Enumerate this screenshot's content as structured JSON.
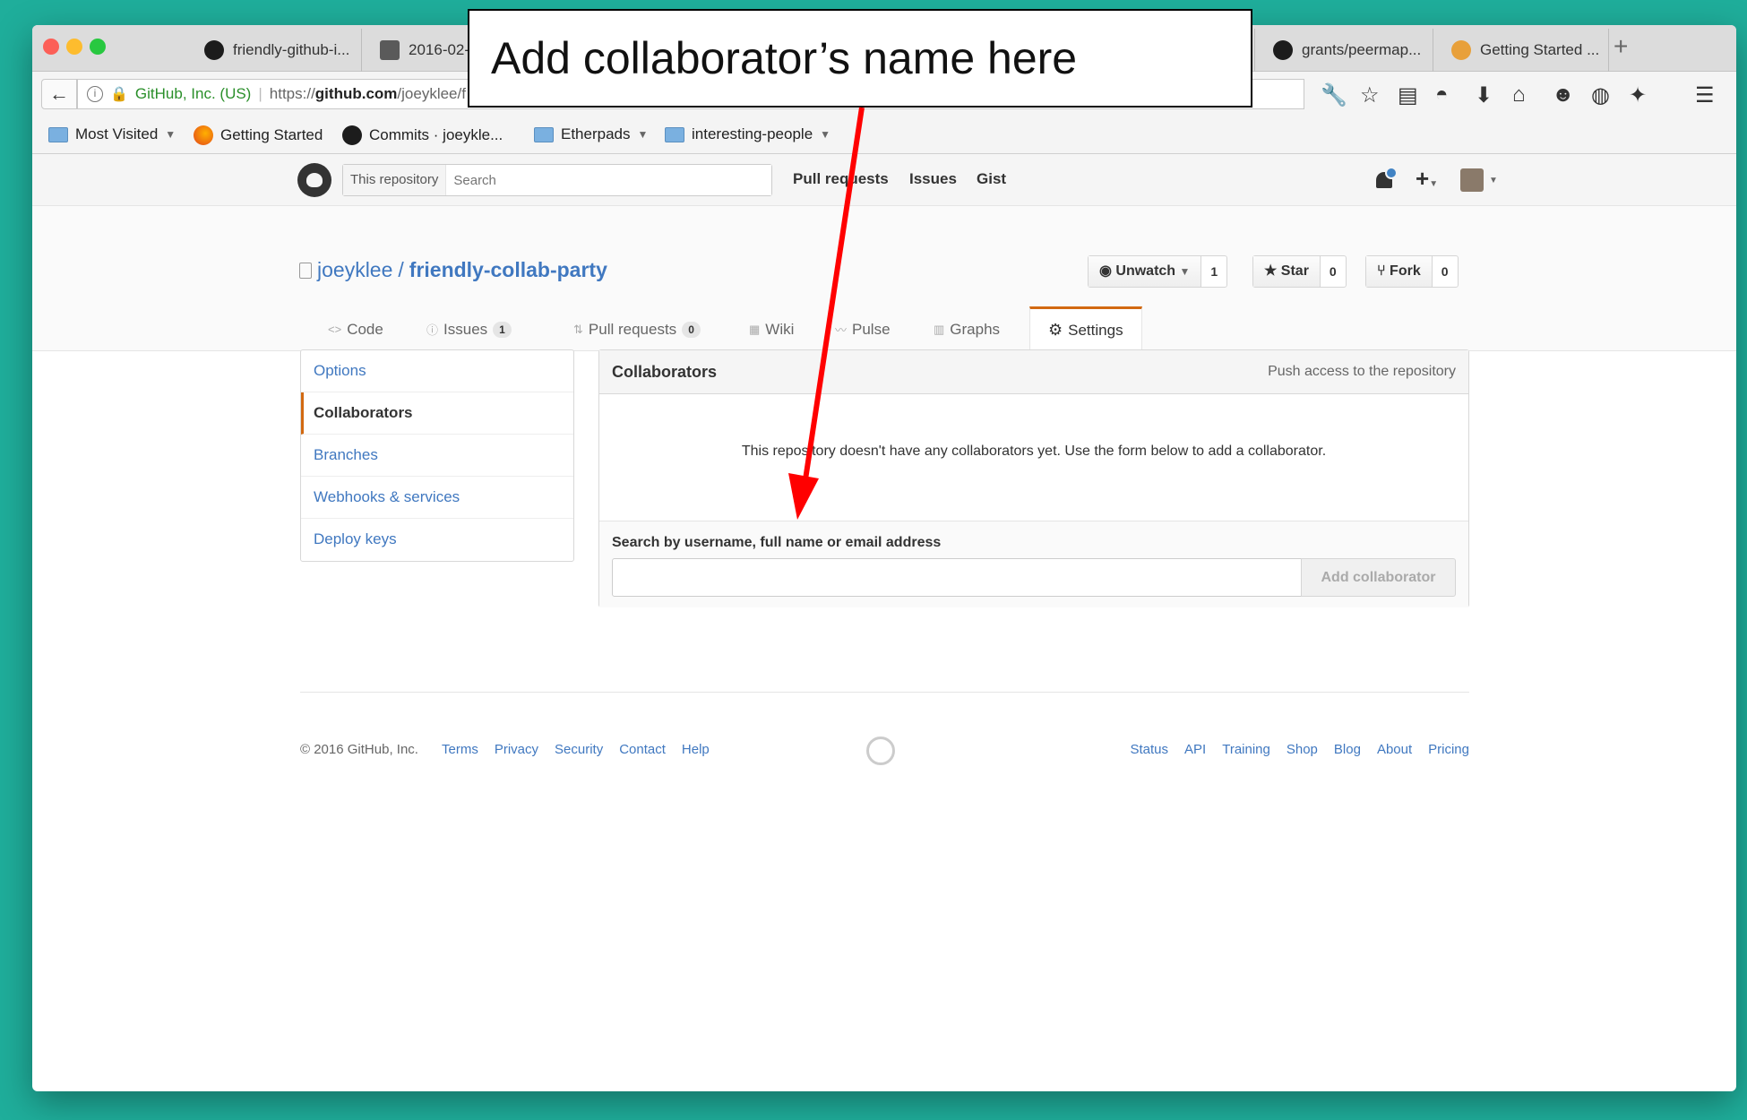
{
  "browser": {
    "tabs": [
      {
        "title": "friendly-github-i...",
        "icon": "github-icon"
      },
      {
        "title": "2016-02-",
        "icon": "notepad-icon"
      },
      {
        "title": "grants/peermap...",
        "icon": "github-icon"
      },
      {
        "title": "Getting Started ...",
        "icon": "flower-icon"
      }
    ],
    "new_tab": "+",
    "site_identity": "GitHub, Inc. (US)",
    "url_prefix": "https://",
    "url_domain": "github.com",
    "url_path": "/joeyklee/f",
    "bookmarks": [
      {
        "label": "Most Visited",
        "has_caret": true
      },
      {
        "label": "Getting Started",
        "has_caret": false
      },
      {
        "label": "Commits · joeykle...",
        "has_caret": false
      },
      {
        "label": "Etherpads",
        "has_caret": true
      },
      {
        "label": "interesting-people",
        "has_caret": true
      }
    ]
  },
  "github": {
    "search_scope": "This repository",
    "search_placeholder": "Search",
    "nav": [
      "Pull requests",
      "Issues",
      "Gist"
    ],
    "plus_label": "+",
    "owner": "joeyklee",
    "separator": "/",
    "repo": "friendly-collab-party",
    "watch_label": "Unwatch",
    "watch_count": "1",
    "star_label": "Star",
    "star_count": "0",
    "fork_label": "Fork",
    "fork_count": "0",
    "repo_tabs": [
      {
        "label": "Code",
        "icon": "code-icon",
        "count": ""
      },
      {
        "label": "Issues",
        "icon": "issue-icon",
        "count": "1"
      },
      {
        "label": "Pull requests",
        "icon": "pull-request-icon",
        "count": "0"
      },
      {
        "label": "Wiki",
        "icon": "wiki-icon",
        "count": ""
      },
      {
        "label": "Pulse",
        "icon": "pulse-icon",
        "count": ""
      },
      {
        "label": "Graphs",
        "icon": "graph-icon",
        "count": ""
      },
      {
        "label": "Settings",
        "icon": "gear-icon",
        "count": ""
      }
    ],
    "settings_menu": [
      "Options",
      "Collaborators",
      "Branches",
      "Webhooks & services",
      "Deploy keys"
    ],
    "selected_menu": "Collaborators",
    "collab_title": "Collaborators",
    "collab_note": "Push access to the repository",
    "empty_message": "This repository doesn't have any collaborators yet. Use the form below to add a collaborator.",
    "search_label": "Search by username, full name or email address",
    "collab_input_value": "",
    "add_button": "Add collaborator",
    "footer_copyright": "© 2016 GitHub, Inc.",
    "footer_left": [
      "Terms",
      "Privacy",
      "Security",
      "Contact",
      "Help"
    ],
    "footer_right": [
      "Status",
      "API",
      "Training",
      "Shop",
      "Blog",
      "About",
      "Pricing"
    ]
  },
  "annotation": {
    "callout_text": "Add collaborator’s name here",
    "arrow_color": "#ff0000"
  },
  "colors": {
    "background": "#1fae9b",
    "link": "#4078c0",
    "accent_orange": "#d26911"
  }
}
